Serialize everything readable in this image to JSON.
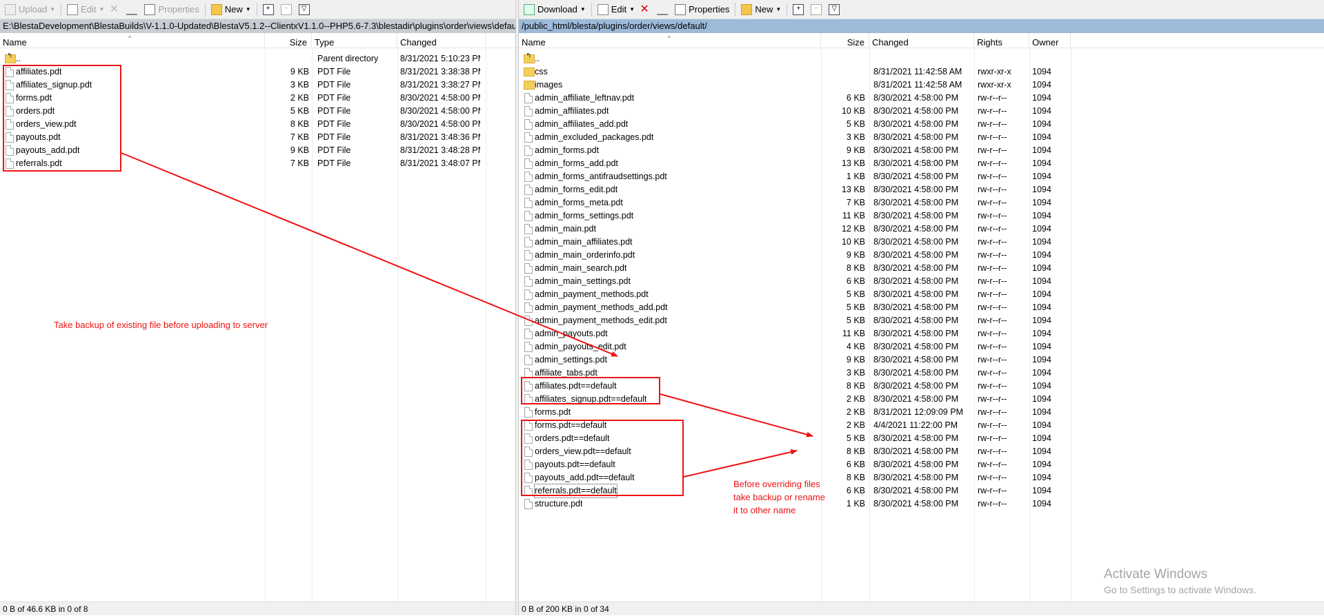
{
  "left": {
    "toolbar": {
      "upload": "Upload",
      "edit": "Edit",
      "properties": "Properties",
      "new": "New"
    },
    "path": "E:\\BlestaDevelopment\\BlestaBuilds\\V-1.1.0-Updated\\BlestaV5.1.2--ClientxV1.1.0--PHP5.6-7.3\\blestadir\\plugins\\order\\views\\default\\",
    "columns": {
      "name": "Name",
      "size": "Size",
      "type": "Type",
      "changed": "Changed"
    },
    "parent": {
      "name": "..",
      "type": "Parent directory",
      "changed": "8/31/2021  5:10:23 PM"
    },
    "files": [
      {
        "name": "affiliates.pdt",
        "size": "9 KB",
        "type": "PDT File",
        "changed": "8/31/2021  3:38:38 PM"
      },
      {
        "name": "affiliates_signup.pdt",
        "size": "3 KB",
        "type": "PDT File",
        "changed": "8/31/2021  3:38:27 PM"
      },
      {
        "name": "forms.pdt",
        "size": "2 KB",
        "type": "PDT File",
        "changed": "8/30/2021  4:58:00 PM"
      },
      {
        "name": "orders.pdt",
        "size": "5 KB",
        "type": "PDT File",
        "changed": "8/30/2021  4:58:00 PM"
      },
      {
        "name": "orders_view.pdt",
        "size": "8 KB",
        "type": "PDT File",
        "changed": "8/30/2021  4:58:00 PM"
      },
      {
        "name": "payouts.pdt",
        "size": "7 KB",
        "type": "PDT File",
        "changed": "8/31/2021  3:48:36 PM"
      },
      {
        "name": "payouts_add.pdt",
        "size": "9 KB",
        "type": "PDT File",
        "changed": "8/31/2021  3:48:28 PM"
      },
      {
        "name": "referrals.pdt",
        "size": "7 KB",
        "type": "PDT File",
        "changed": "8/31/2021  3:48:07 PM"
      }
    ],
    "status": "0 B of 46.6 KB in 0 of 8",
    "note": "Take backup of existing file before uploading to server"
  },
  "right": {
    "toolbar": {
      "download": "Download",
      "edit": "Edit",
      "properties": "Properties",
      "new": "New"
    },
    "path": "/public_html/blesta/plugins/order/views/default/",
    "columns": {
      "name": "Name",
      "size": "Size",
      "changed": "Changed",
      "rights": "Rights",
      "owner": "Owner"
    },
    "parent": {
      "name": ".."
    },
    "folders": [
      {
        "name": "css",
        "changed": "8/31/2021 11:42:58 AM",
        "rights": "rwxr-xr-x",
        "owner": "1094"
      },
      {
        "name": "images",
        "changed": "8/31/2021 11:42:58 AM",
        "rights": "rwxr-xr-x",
        "owner": "1094"
      }
    ],
    "files": [
      {
        "name": "admin_affiliate_leftnav.pdt",
        "size": "6 KB",
        "changed": "8/30/2021 4:58:00 PM",
        "rights": "rw-r--r--",
        "owner": "1094"
      },
      {
        "name": "admin_affiliates.pdt",
        "size": "10 KB",
        "changed": "8/30/2021 4:58:00 PM",
        "rights": "rw-r--r--",
        "owner": "1094"
      },
      {
        "name": "admin_affiliates_add.pdt",
        "size": "5 KB",
        "changed": "8/30/2021 4:58:00 PM",
        "rights": "rw-r--r--",
        "owner": "1094"
      },
      {
        "name": "admin_excluded_packages.pdt",
        "size": "3 KB",
        "changed": "8/30/2021 4:58:00 PM",
        "rights": "rw-r--r--",
        "owner": "1094"
      },
      {
        "name": "admin_forms.pdt",
        "size": "9 KB",
        "changed": "8/30/2021 4:58:00 PM",
        "rights": "rw-r--r--",
        "owner": "1094"
      },
      {
        "name": "admin_forms_add.pdt",
        "size": "13 KB",
        "changed": "8/30/2021 4:58:00 PM",
        "rights": "rw-r--r--",
        "owner": "1094"
      },
      {
        "name": "admin_forms_antifraudsettings.pdt",
        "size": "1 KB",
        "changed": "8/30/2021 4:58:00 PM",
        "rights": "rw-r--r--",
        "owner": "1094"
      },
      {
        "name": "admin_forms_edit.pdt",
        "size": "13 KB",
        "changed": "8/30/2021 4:58:00 PM",
        "rights": "rw-r--r--",
        "owner": "1094"
      },
      {
        "name": "admin_forms_meta.pdt",
        "size": "7 KB",
        "changed": "8/30/2021 4:58:00 PM",
        "rights": "rw-r--r--",
        "owner": "1094"
      },
      {
        "name": "admin_forms_settings.pdt",
        "size": "11 KB",
        "changed": "8/30/2021 4:58:00 PM",
        "rights": "rw-r--r--",
        "owner": "1094"
      },
      {
        "name": "admin_main.pdt",
        "size": "12 KB",
        "changed": "8/30/2021 4:58:00 PM",
        "rights": "rw-r--r--",
        "owner": "1094"
      },
      {
        "name": "admin_main_affiliates.pdt",
        "size": "10 KB",
        "changed": "8/30/2021 4:58:00 PM",
        "rights": "rw-r--r--",
        "owner": "1094"
      },
      {
        "name": "admin_main_orderinfo.pdt",
        "size": "9 KB",
        "changed": "8/30/2021 4:58:00 PM",
        "rights": "rw-r--r--",
        "owner": "1094"
      },
      {
        "name": "admin_main_search.pdt",
        "size": "8 KB",
        "changed": "8/30/2021 4:58:00 PM",
        "rights": "rw-r--r--",
        "owner": "1094"
      },
      {
        "name": "admin_main_settings.pdt",
        "size": "6 KB",
        "changed": "8/30/2021 4:58:00 PM",
        "rights": "rw-r--r--",
        "owner": "1094"
      },
      {
        "name": "admin_payment_methods.pdt",
        "size": "5 KB",
        "changed": "8/30/2021 4:58:00 PM",
        "rights": "rw-r--r--",
        "owner": "1094"
      },
      {
        "name": "admin_payment_methods_add.pdt",
        "size": "5 KB",
        "changed": "8/30/2021 4:58:00 PM",
        "rights": "rw-r--r--",
        "owner": "1094"
      },
      {
        "name": "admin_payment_methods_edit.pdt",
        "size": "5 KB",
        "changed": "8/30/2021 4:58:00 PM",
        "rights": "rw-r--r--",
        "owner": "1094"
      },
      {
        "name": "admin_payouts.pdt",
        "size": "11 KB",
        "changed": "8/30/2021 4:58:00 PM",
        "rights": "rw-r--r--",
        "owner": "1094"
      },
      {
        "name": "admin_payouts_edit.pdt",
        "size": "4 KB",
        "changed": "8/30/2021 4:58:00 PM",
        "rights": "rw-r--r--",
        "owner": "1094"
      },
      {
        "name": "admin_settings.pdt",
        "size": "9 KB",
        "changed": "8/30/2021 4:58:00 PM",
        "rights": "rw-r--r--",
        "owner": "1094"
      },
      {
        "name": "affiliate_tabs.pdt",
        "size": "3 KB",
        "changed": "8/30/2021 4:58:00 PM",
        "rights": "rw-r--r--",
        "owner": "1094"
      },
      {
        "name": "affiliates.pdt==default",
        "size": "8 KB",
        "changed": "8/30/2021 4:58:00 PM",
        "rights": "rw-r--r--",
        "owner": "1094"
      },
      {
        "name": "affiliates_signup.pdt==default",
        "size": "2 KB",
        "changed": "8/30/2021 4:58:00 PM",
        "rights": "rw-r--r--",
        "owner": "1094"
      },
      {
        "name": "forms.pdt",
        "size": "2 KB",
        "changed": "8/31/2021 12:09:09 PM",
        "rights": "rw-r--r--",
        "owner": "1094"
      },
      {
        "name": "forms.pdt==default",
        "size": "2 KB",
        "changed": "4/4/2021 11:22:00 PM",
        "rights": "rw-r--r--",
        "owner": "1094"
      },
      {
        "name": "orders.pdt==default",
        "size": "5 KB",
        "changed": "8/30/2021 4:58:00 PM",
        "rights": "rw-r--r--",
        "owner": "1094"
      },
      {
        "name": "orders_view.pdt==default",
        "size": "8 KB",
        "changed": "8/30/2021 4:58:00 PM",
        "rights": "rw-r--r--",
        "owner": "1094"
      },
      {
        "name": "payouts.pdt==default",
        "size": "6 KB",
        "changed": "8/30/2021 4:58:00 PM",
        "rights": "rw-r--r--",
        "owner": "1094"
      },
      {
        "name": "payouts_add.pdt==default",
        "size": "8 KB",
        "changed": "8/30/2021 4:58:00 PM",
        "rights": "rw-r--r--",
        "owner": "1094"
      },
      {
        "name": "referrals.pdt==default",
        "size": "6 KB",
        "changed": "8/30/2021 4:58:00 PM",
        "rights": "rw-r--r--",
        "owner": "1094"
      },
      {
        "name": "structure.pdt",
        "size": "1 KB",
        "changed": "8/30/2021 4:58:00 PM",
        "rights": "rw-r--r--",
        "owner": "1094"
      }
    ],
    "status": "0 B of 200 KB in 0 of 34",
    "note": [
      "Before overriding files",
      "take backup or rename",
      "it to other name"
    ]
  },
  "watermark": {
    "title": "Activate Windows",
    "subtitle": "Go to Settings to activate Windows."
  },
  "colors": {
    "annotation": "#e11111",
    "path_bar": "#9dbad9"
  }
}
